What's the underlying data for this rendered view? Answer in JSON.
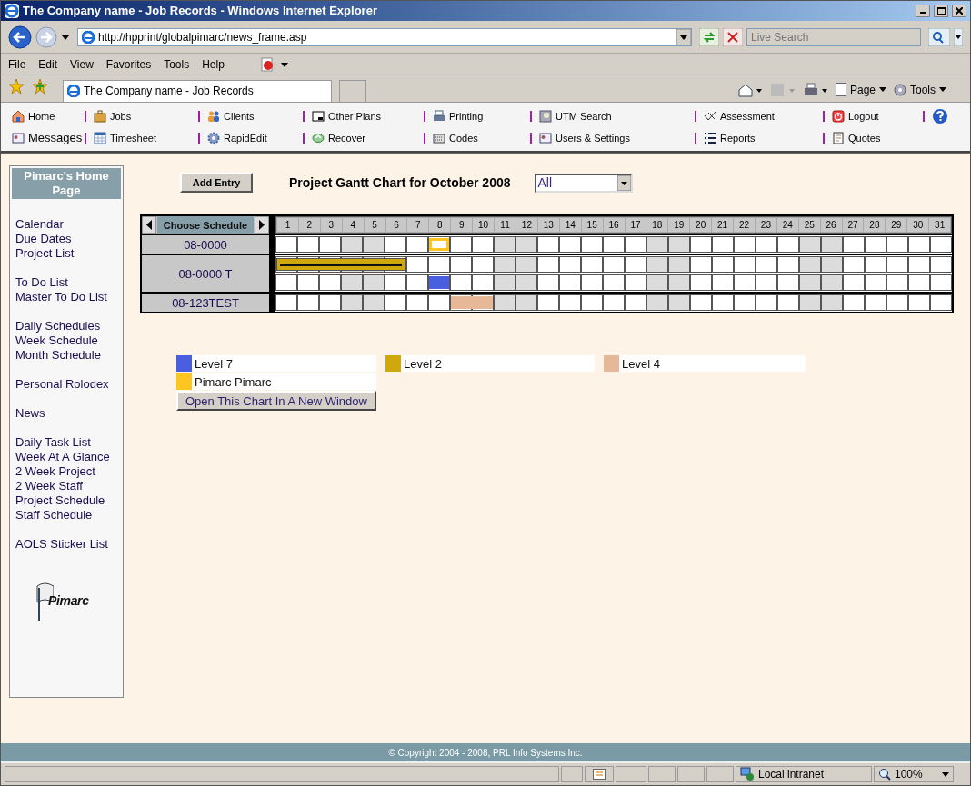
{
  "window": {
    "title": "The Company name - Job Records - Windows Internet Explorer"
  },
  "address_bar": {
    "url": "http://hpprint/globalpimarc/news_frame.asp"
  },
  "search": {
    "placeholder": "Live Search"
  },
  "menu_bar": [
    "File",
    "Edit",
    "View",
    "Favorites",
    "Tools",
    "Help"
  ],
  "tab": {
    "title": "The Company name - Job Records"
  },
  "command_bar": [
    "Page",
    "Tools"
  ],
  "nav": [
    [
      {
        "label": "Home",
        "kind": "home"
      },
      {
        "label": "Messages",
        "kind": "card"
      }
    ],
    [
      {
        "label": "Jobs",
        "kind": "briefcase"
      },
      {
        "label": "Timesheet",
        "kind": "calendar"
      }
    ],
    [
      {
        "label": "Clients",
        "kind": "people"
      },
      {
        "label": "RapidEdit",
        "kind": "gear"
      }
    ],
    [
      {
        "label": "Other Plans",
        "kind": "window"
      },
      {
        "label": "Recover",
        "kind": "recycle"
      }
    ],
    [
      {
        "label": "Printing",
        "kind": "printer"
      },
      {
        "label": "Codes",
        "kind": "keyboard"
      }
    ],
    [
      {
        "label": "UTM Search",
        "kind": "scope"
      },
      {
        "label": "Users & Settings",
        "kind": "card"
      }
    ],
    [
      {
        "label": "Assessment",
        "kind": "check"
      },
      {
        "label": "Reports",
        "kind": "list"
      }
    ],
    [
      {
        "label": "Logout",
        "kind": "power"
      },
      {
        "label": "Quotes",
        "kind": "doc"
      }
    ]
  ],
  "sidebar": {
    "title": "Pimarc's Home Page",
    "groups": [
      [
        "Calendar",
        "Due Dates",
        "Project List"
      ],
      [
        "To Do List",
        "Master To Do List"
      ],
      [
        "Daily Schedules",
        "Week Schedule",
        "Month Schedule"
      ],
      [
        "Personal Rolodex"
      ],
      [
        "News"
      ],
      [
        "Daily Task List",
        "Week At A Glance",
        "2 Week Project",
        "2 Week Staff",
        "Project Schedule",
        "Staff Schedule"
      ],
      [
        "AOLS Sticker List"
      ]
    ],
    "logo": "Pimarc"
  },
  "toolbar": {
    "add_button": "Add Entry",
    "heading": "Project Gantt Chart for October 2008",
    "filter": "All"
  },
  "gantt": {
    "choose_label": "Choose Schedule",
    "days": [
      {
        "label": "1",
        "shaded": false
      },
      {
        "label": "2",
        "shaded": false
      },
      {
        "label": "3",
        "shaded": false
      },
      {
        "label": "4",
        "shaded": true
      },
      {
        "label": "5",
        "shaded": true
      },
      {
        "label": "6",
        "shaded": false
      },
      {
        "label": "7",
        "shaded": false
      },
      {
        "label": "8",
        "shaded": false
      },
      {
        "label": "9",
        "shaded": false
      },
      {
        "label": "10",
        "shaded": false
      },
      {
        "label": "11",
        "shaded": true
      },
      {
        "label": "12",
        "shaded": true
      },
      {
        "label": "13",
        "shaded": false
      },
      {
        "label": "14",
        "shaded": false
      },
      {
        "label": "15",
        "shaded": false
      },
      {
        "label": "16",
        "shaded": false
      },
      {
        "label": "17",
        "shaded": false
      },
      {
        "label": "18",
        "shaded": true
      },
      {
        "label": "19",
        "shaded": true
      },
      {
        "label": "20",
        "shaded": false
      },
      {
        "label": "21",
        "shaded": false
      },
      {
        "label": "22",
        "shaded": false
      },
      {
        "label": "23",
        "shaded": false
      },
      {
        "label": "24",
        "shaded": false
      },
      {
        "label": "25",
        "shaded": true
      },
      {
        "label": "26",
        "shaded": true
      },
      {
        "label": "27",
        "shaded": false
      },
      {
        "label": "28",
        "shaded": false
      },
      {
        "label": "29",
        "shaded": false
      },
      {
        "label": "30",
        "shaded": false
      },
      {
        "label": "31",
        "shaded": false
      }
    ],
    "rows": [
      {
        "project": "08-0000",
        "lines": [
          [
            {
              "kind": "blank"
            },
            {
              "kind": "blank"
            },
            {
              "kind": "blank"
            },
            {
              "kind": "blank"
            },
            {
              "kind": "blank"
            },
            {
              "kind": "blank"
            },
            {
              "kind": "blank"
            },
            {
              "kind": "outline",
              "color": "#ffc520"
            },
            {
              "kind": "blank"
            },
            {
              "kind": "blank"
            },
            {
              "kind": "blank"
            },
            {
              "kind": "blank"
            },
            {
              "kind": "blank"
            },
            {
              "kind": "blank"
            },
            {
              "kind": "blank"
            },
            {
              "kind": "blank"
            },
            {
              "kind": "blank"
            },
            {
              "kind": "blank"
            },
            {
              "kind": "blank"
            },
            {
              "kind": "blank"
            },
            {
              "kind": "blank"
            },
            {
              "kind": "blank"
            },
            {
              "kind": "blank"
            },
            {
              "kind": "blank"
            },
            {
              "kind": "blank"
            },
            {
              "kind": "blank"
            },
            {
              "kind": "blank"
            },
            {
              "kind": "blank"
            },
            {
              "kind": "blank"
            },
            {
              "kind": "blank"
            },
            {
              "kind": "blank"
            }
          ]
        ]
      },
      {
        "project": "08-0000 T",
        "lines": [
          [
            {
              "kind": "lined",
              "color": "#cfa80e"
            },
            {
              "kind": "lined",
              "color": "#cfa80e"
            },
            {
              "kind": "lined",
              "color": "#cfa80e"
            },
            {
              "kind": "lined",
              "color": "#cfa80e"
            },
            {
              "kind": "lined",
              "color": "#cfa80e"
            },
            {
              "kind": "lined",
              "color": "#cfa80e"
            },
            {
              "kind": "blank"
            },
            {
              "kind": "blank"
            },
            {
              "kind": "blank"
            },
            {
              "kind": "blank"
            },
            {
              "kind": "blank"
            },
            {
              "kind": "blank"
            },
            {
              "kind": "blank"
            },
            {
              "kind": "blank"
            },
            {
              "kind": "blank"
            },
            {
              "kind": "blank"
            },
            {
              "kind": "blank"
            },
            {
              "kind": "blank"
            },
            {
              "kind": "blank"
            },
            {
              "kind": "blank"
            },
            {
              "kind": "blank"
            },
            {
              "kind": "blank"
            },
            {
              "kind": "blank"
            },
            {
              "kind": "blank"
            },
            {
              "kind": "blank"
            },
            {
              "kind": "blank"
            },
            {
              "kind": "blank"
            },
            {
              "kind": "blank"
            },
            {
              "kind": "blank"
            },
            {
              "kind": "blank"
            },
            {
              "kind": "blank"
            }
          ],
          [
            {
              "kind": "blank"
            },
            {
              "kind": "blank"
            },
            {
              "kind": "blank"
            },
            {
              "kind": "blank"
            },
            {
              "kind": "blank"
            },
            {
              "kind": "blank"
            },
            {
              "kind": "blank"
            },
            {
              "kind": "fill",
              "color": "#4a5fe0"
            },
            {
              "kind": "blank"
            },
            {
              "kind": "blank"
            },
            {
              "kind": "blank"
            },
            {
              "kind": "blank"
            },
            {
              "kind": "blank"
            },
            {
              "kind": "blank"
            },
            {
              "kind": "blank"
            },
            {
              "kind": "blank"
            },
            {
              "kind": "blank"
            },
            {
              "kind": "blank"
            },
            {
              "kind": "blank"
            },
            {
              "kind": "blank"
            },
            {
              "kind": "blank"
            },
            {
              "kind": "blank"
            },
            {
              "kind": "blank"
            },
            {
              "kind": "blank"
            },
            {
              "kind": "blank"
            },
            {
              "kind": "blank"
            },
            {
              "kind": "blank"
            },
            {
              "kind": "blank"
            },
            {
              "kind": "blank"
            },
            {
              "kind": "blank"
            },
            {
              "kind": "blank"
            }
          ]
        ]
      },
      {
        "project": "08-123TEST",
        "lines": [
          [
            {
              "kind": "blank"
            },
            {
              "kind": "blank"
            },
            {
              "kind": "blank"
            },
            {
              "kind": "blank"
            },
            {
              "kind": "blank"
            },
            {
              "kind": "blank"
            },
            {
              "kind": "blank"
            },
            {
              "kind": "blank"
            },
            {
              "kind": "fill",
              "color": "#e6b898"
            },
            {
              "kind": "fill",
              "color": "#e6b898"
            },
            {
              "kind": "blank"
            },
            {
              "kind": "blank"
            },
            {
              "kind": "blank"
            },
            {
              "kind": "blank"
            },
            {
              "kind": "blank"
            },
            {
              "kind": "blank"
            },
            {
              "kind": "blank"
            },
            {
              "kind": "blank"
            },
            {
              "kind": "blank"
            },
            {
              "kind": "blank"
            },
            {
              "kind": "blank"
            },
            {
              "kind": "blank"
            },
            {
              "kind": "blank"
            },
            {
              "kind": "blank"
            },
            {
              "kind": "blank"
            },
            {
              "kind": "blank"
            },
            {
              "kind": "blank"
            },
            {
              "kind": "blank"
            },
            {
              "kind": "blank"
            },
            {
              "kind": "blank"
            },
            {
              "kind": "blank"
            }
          ]
        ]
      }
    ]
  },
  "legend": [
    {
      "label": "Level 7",
      "color": "#4a5fe0"
    },
    {
      "label": "Level 2",
      "color": "#cfa80e"
    },
    {
      "label": "Level 4",
      "color": "#e6b898"
    },
    {
      "label": "Pimarc Pimarc",
      "color": "#ffc520"
    }
  ],
  "open_button": "Open This Chart In A New Window",
  "footer": "© Copyright 2004 - 2008, PRL Info Systems Inc.",
  "status_bar": {
    "zone": "Local intranet",
    "zoom": "100%"
  }
}
